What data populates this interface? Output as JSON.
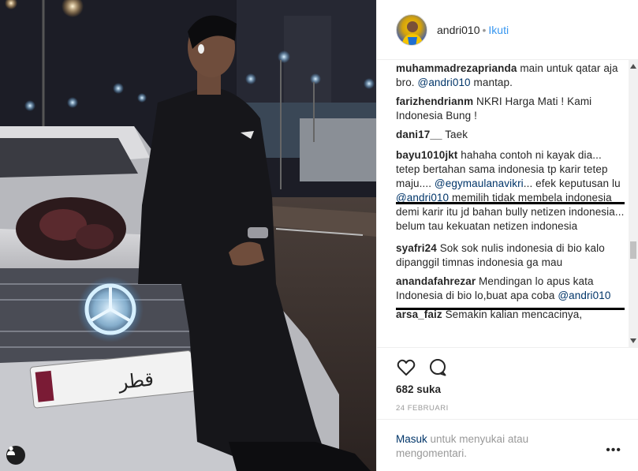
{
  "header": {
    "username": "andri010",
    "separator": "•",
    "follow_label": "Ikuti"
  },
  "comments": [
    {
      "user": "muhammadrezaprianda",
      "pre": "main untuk qatar aja bro. ",
      "mention": "@andri010",
      "post": " mantap."
    },
    {
      "user": "farizhendrianm",
      "pre": "NKRI Harga Mati ! Kami Indonesia Bung !",
      "mention": "",
      "post": ""
    },
    {
      "user": "dani17__",
      "pre": "Taek",
      "mention": "",
      "post": ""
    },
    {
      "user": "bayu1010jkt",
      "pre": "hahaha contoh ni kayak dia... tetep bertahan sama indonesia tp karir tetep maju.... ",
      "mention": "@egymaulanavikri",
      "mid": "... efek keputusan lu ",
      "mention2": "@andri010",
      "post": " memilih tidak membela indonesia demi karir itu jd bahan bully netizen indonesia... belum tau kekuatan netizen indonesia"
    },
    {
      "user": "syafri24",
      "pre": "Sok sok nulis indonesia di bio kalo dipanggil timnas indonesia ga mau",
      "mention": "",
      "post": ""
    },
    {
      "user": "anandafahrezar",
      "pre": "Mendingan lo apus kata Indonesia di bio lo,buat apa coba ",
      "mention": "@andri010",
      "post": ""
    },
    {
      "user": "arsa_faiz",
      "pre": "Semakin kalian mencacinya,",
      "mention": "",
      "post": ""
    }
  ],
  "actions": {
    "like_icon": "heart-icon",
    "comment_icon": "comment-icon",
    "likes": "682 suka",
    "date": "24 FEBRUARI"
  },
  "login": {
    "link": "Masuk",
    "text": " untuk menyukai atau mengomentari.",
    "more": "•••"
  },
  "photo": {
    "plate_text": "قطر",
    "plate_side": "QATAR"
  },
  "colors": {
    "link_blue": "#3897f0",
    "mention_navy": "#003569",
    "muted_gray": "#999999",
    "highlight_border": "#000000"
  }
}
